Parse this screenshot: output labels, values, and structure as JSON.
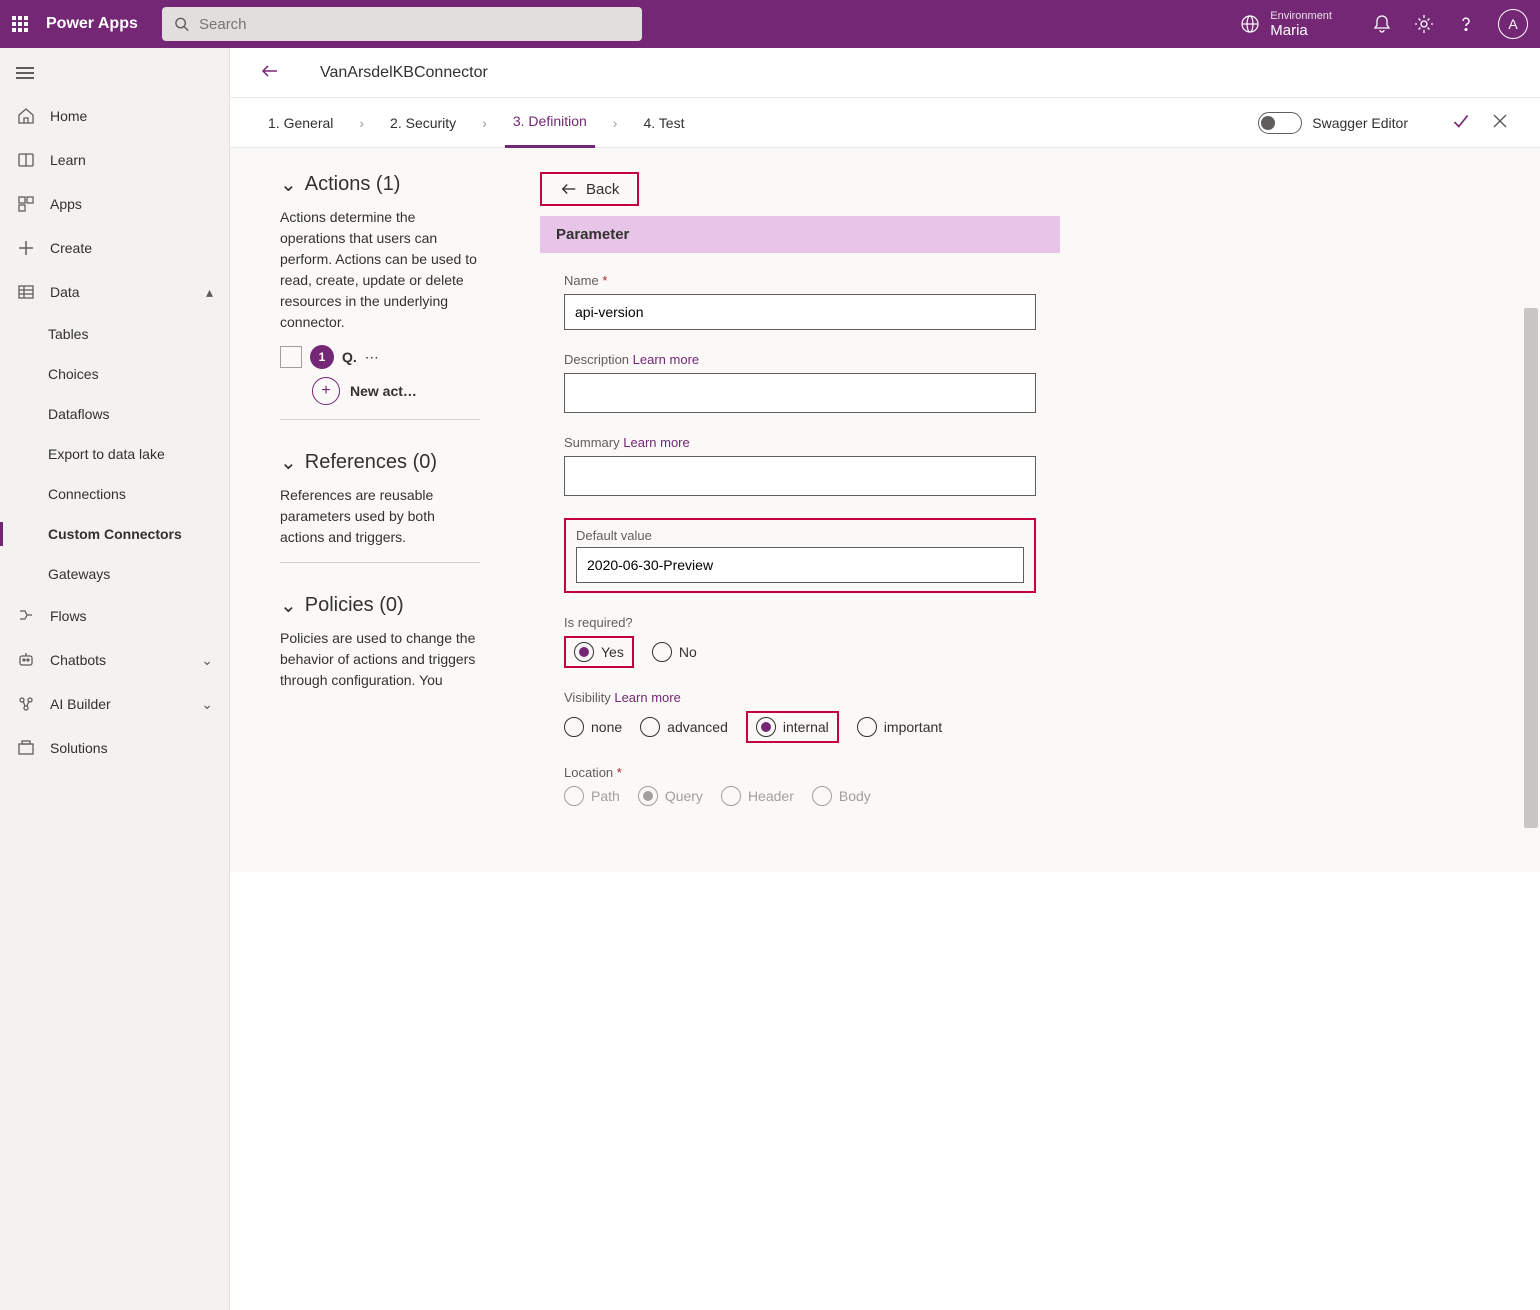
{
  "header": {
    "app_name": "Power Apps",
    "search_placeholder": "Search",
    "env_label": "Environment",
    "env_name": "Maria",
    "avatar_initial": "A"
  },
  "nav": {
    "items": [
      {
        "label": "Home"
      },
      {
        "label": "Learn"
      },
      {
        "label": "Apps"
      },
      {
        "label": "Create"
      },
      {
        "label": "Data"
      },
      {
        "label": "Tables",
        "sub": true
      },
      {
        "label": "Choices",
        "sub": true
      },
      {
        "label": "Dataflows",
        "sub": true
      },
      {
        "label": "Export to data lake",
        "sub": true
      },
      {
        "label": "Connections",
        "sub": true
      },
      {
        "label": "Custom Connectors",
        "sub": true,
        "active": true
      },
      {
        "label": "Gateways",
        "sub": true
      },
      {
        "label": "Flows"
      },
      {
        "label": "Chatbots"
      },
      {
        "label": "AI Builder"
      },
      {
        "label": "Solutions"
      }
    ]
  },
  "page": {
    "title": "VanArsdelKBConnector",
    "steps": [
      "1. General",
      "2. Security",
      "3. Definition",
      "4. Test"
    ],
    "active_step_index": 2,
    "swagger_label": "Swagger Editor"
  },
  "actions_panel": {
    "title": "Actions (1)",
    "desc": "Actions determine the operations that users can perform. Actions can be used to read, create, update or delete resources in the underlying connector.",
    "badge": "1",
    "item_label": "Q.",
    "new_action": "New act…"
  },
  "references_panel": {
    "title": "References (0)",
    "desc": "References are reusable parameters used by both actions and triggers."
  },
  "policies_panel": {
    "title": "Policies (0)",
    "desc": "Policies are used to change the behavior of actions and triggers through configuration. You"
  },
  "form": {
    "back": "Back",
    "section_title": "Parameter",
    "name_label": "Name",
    "name_value": "api-version",
    "description_label": "Description",
    "description_value": "",
    "learn_more": "Learn more",
    "summary_label": "Summary",
    "summary_value": "",
    "default_label": "Default value",
    "default_value": "2020-06-30-Preview",
    "required_label": "Is required?",
    "required_options": [
      "Yes",
      "No"
    ],
    "required_selected": "Yes",
    "visibility_label": "Visibility",
    "visibility_options": [
      "none",
      "advanced",
      "internal",
      "important"
    ],
    "visibility_selected": "internal",
    "location_label": "Location",
    "location_options": [
      "Path",
      "Query",
      "Header",
      "Body"
    ],
    "location_selected": "Query"
  }
}
